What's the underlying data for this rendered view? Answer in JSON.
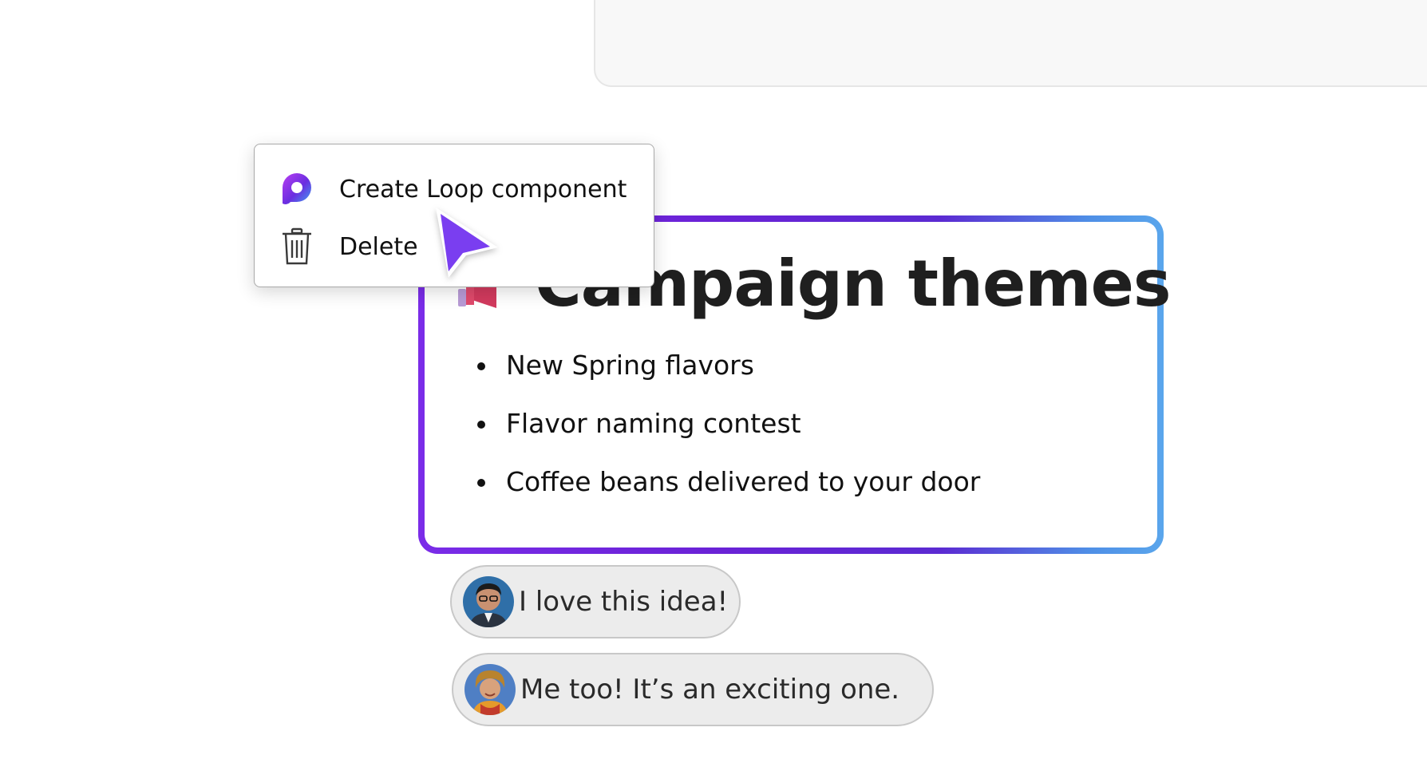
{
  "menu": {
    "items": [
      {
        "label": "Create Loop component",
        "icon": "loop-icon"
      },
      {
        "label": "Delete",
        "icon": "trash-icon"
      }
    ]
  },
  "card": {
    "title": "Campaign themes",
    "emoji": "megaphone-icon",
    "items": [
      "New Spring flavors",
      "Flavor naming contest",
      "Coffee beans delivered to your door"
    ],
    "border_gradient": [
      "#7a2ce8",
      "#5b2ad2",
      "#5aa6ec"
    ]
  },
  "comments": [
    {
      "text": "I love this idea!",
      "avatar": "avatar-man-glasses"
    },
    {
      "text": "Me too! It’s an exciting one.",
      "avatar": "avatar-woman-smiling"
    }
  ],
  "cursor": {
    "color": "#7a3ef0"
  }
}
